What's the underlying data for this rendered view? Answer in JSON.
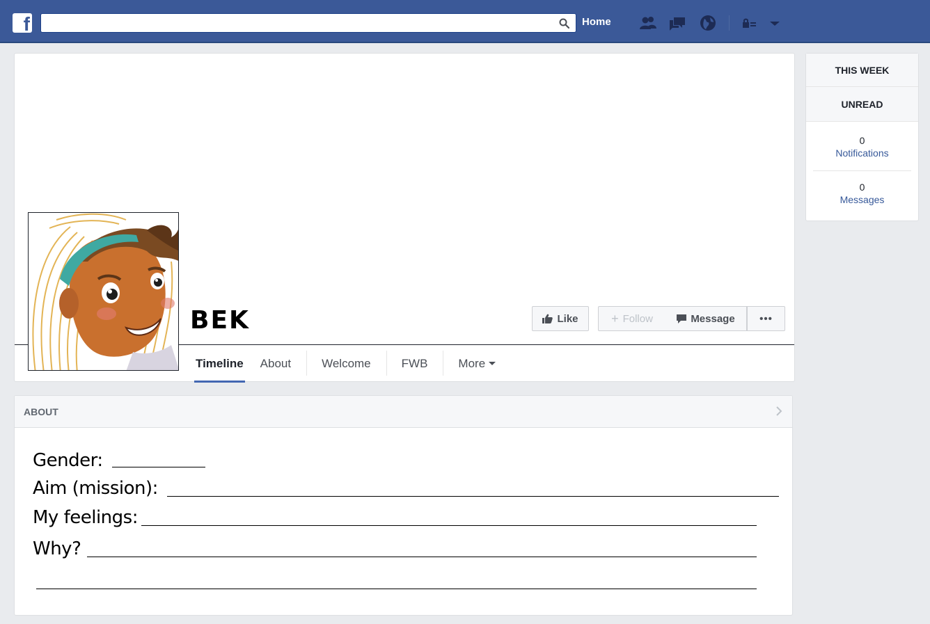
{
  "topbar": {
    "logo_letter": "f",
    "search_placeholder": "",
    "home_label": "Home",
    "icons": [
      "friends-icon",
      "messages-icon",
      "notifications-globe-icon",
      "privacy-shortcuts-icon",
      "account-menu-chevron-icon"
    ]
  },
  "profile": {
    "name": "BEK",
    "buttons": {
      "like": "Like",
      "follow": "Follow",
      "message": "Message",
      "more": "•••"
    },
    "tabs": [
      {
        "label": "Timeline",
        "active": true
      },
      {
        "label": "About"
      },
      {
        "label": "Welcome"
      },
      {
        "label": "FWB"
      },
      {
        "label": "More"
      }
    ]
  },
  "sidebar": {
    "this_week": "THIS WEEK",
    "unread": "UNREAD",
    "notifications": {
      "count": "0",
      "label": "Notifications"
    },
    "messages": {
      "count": "0",
      "label": "Messages"
    }
  },
  "about": {
    "title": "ABOUT",
    "fields": {
      "gender": "Gender:",
      "aim": "Aim (mission):",
      "feelings": "My feelings:",
      "why": "Why?"
    }
  },
  "colors": {
    "brand_blue": "#3b5998",
    "link_blue": "#365899",
    "active_tab": "#4267b2",
    "page_bg": "#e9ebee"
  }
}
